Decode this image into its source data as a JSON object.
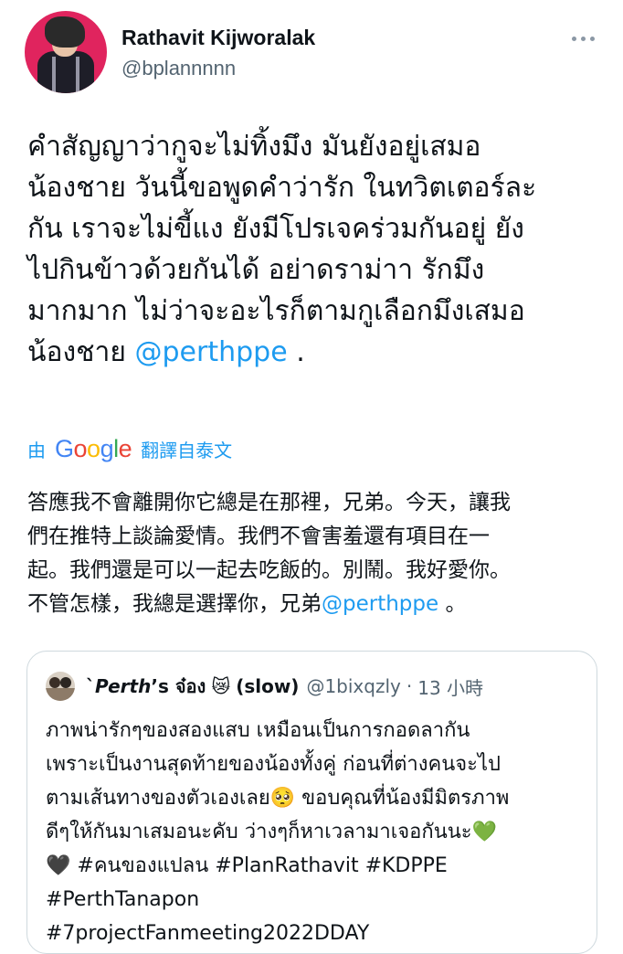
{
  "author": {
    "display_name": "Rathavit Kijworalak",
    "handle": "@bplannnnn",
    "avatar_icon": "profile-photo"
  },
  "tweet": {
    "lines": [
      "คำสัญญาว่ากูจะไม่ทิ้งมึง มันยังอยู่เสมอ",
      "น้องชาย วันนี้ขอพูดคำว่ารัก ในทวิตเตอร์ละ",
      "กัน เราจะไม่ขี้แง ยังมีโปรเจคร่วมกันอยู่ ยัง",
      "ไปกินข้าวด้วยกันได้ อย่าดราม่าา รักมึง",
      "มากมาก ไม่ว่าจะอะไรก็ตามกูเลือกมึงเสมอ"
    ],
    "last_line_prefix": "น้องชาย ",
    "mention": "@perthppe",
    "last_line_suffix": " ."
  },
  "translate": {
    "by_label": "由",
    "google_logo": [
      "G",
      "o",
      "o",
      "g",
      "l",
      "e"
    ],
    "google_colors": [
      "#4285f4",
      "#ea4335",
      "#fbbc05",
      "#4285f4",
      "#34a853",
      "#ea4335"
    ],
    "action_label": "翻譯自泰文"
  },
  "translation": {
    "lines": [
      "答應我不會離開你它總是在那裡，兄弟。今天，讓我",
      "們在推特上談論愛情。我們不會害羞還有項目在一",
      "起。我們還是可以一起去吃飯的。別鬧。我好愛你。"
    ],
    "last_line_prefix": "不管怎樣，我總是選擇你，兄弟",
    "mention": "@perthppe",
    "last_line_suffix": " 。"
  },
  "quoted_tweet": {
    "name_prefix": "`",
    "name_italic": "Perth",
    "name_suffix": "’s จ๋อง",
    "emoji": "😿",
    "name_tail": "(slow)",
    "handle": "@1bixqzly",
    "separator": "·",
    "time": "13 小時",
    "lines": [
      "ภาพน่ารักๆของสองแสบ เหมือนเป็นการกอดลากัน",
      "เพราะเป็นงานสุดท้ายของน้องทั้งคู่ ก่อนที่ต่างคนจะไป"
    ],
    "line3_text": "ตามเส้นทางของตัวเองเลย",
    "line3_emoji": "🥺",
    "line3_suffix": " ขอบคุณที่น้องมีมิตรภาพ",
    "line4_text": "ดีๆให้กันมาเสมอนะคับ ว่างๆก็หาเวลามาเจอกันนะ",
    "green_heart": "💚",
    "black_heart": "🖤",
    "line5_text": " #คนของแปลน #PlanRathavit #KDPPE",
    "line6": "#PerthTanapon",
    "line7": " #7projectFanmeeting2022DDAY",
    "colors": {
      "green_heart": "#3fb11a",
      "black_heart": "#1a1a1a"
    }
  },
  "colors": {
    "link": "#1d9bf0",
    "text": "#0f1419",
    "secondary": "#536471",
    "border": "#cfd9de"
  }
}
